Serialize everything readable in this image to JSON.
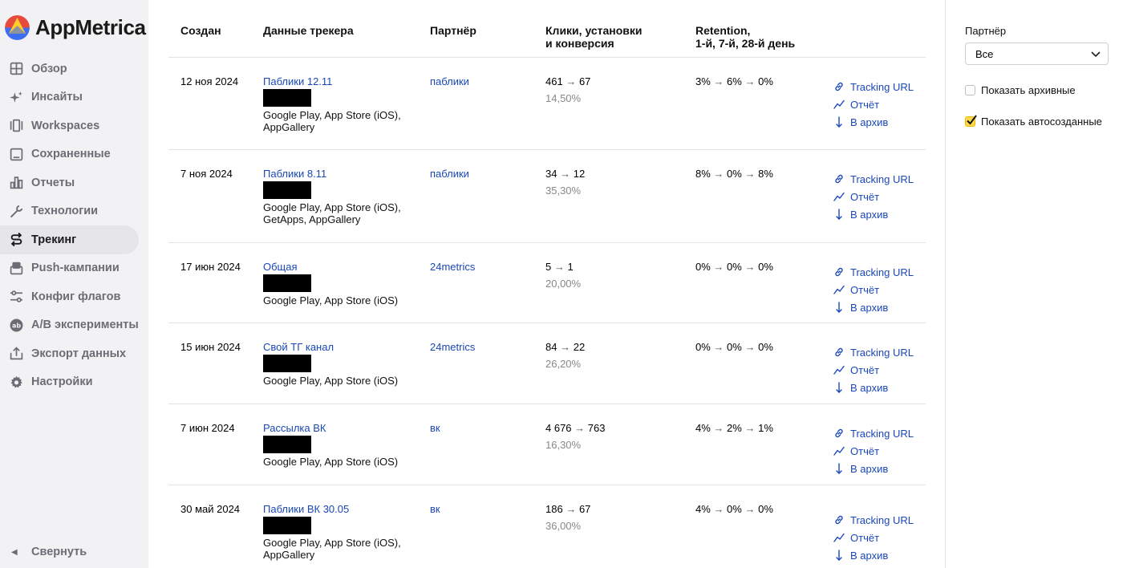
{
  "app": {
    "name": "AppMetrica"
  },
  "sidebar": {
    "items": [
      {
        "label": "Обзор",
        "icon": "overview-grid-icon",
        "active": false
      },
      {
        "label": "Инсайты",
        "icon": "sparkle-icon",
        "active": false
      },
      {
        "label": "Workspaces",
        "icon": "workspaces-icon",
        "active": false
      },
      {
        "label": "Сохраненные",
        "icon": "saved-icon",
        "active": false
      },
      {
        "label": "Отчеты",
        "icon": "reports-chart-icon",
        "active": false
      },
      {
        "label": "Технологии",
        "icon": "wrench-icon",
        "active": false
      },
      {
        "label": "Трекинг",
        "icon": "tracking-icon",
        "active": true
      },
      {
        "label": "Push-кампании",
        "icon": "push-icon",
        "active": false
      },
      {
        "label": "Конфиг флагов",
        "icon": "sliders-icon",
        "active": false
      },
      {
        "label": "A/B эксперименты",
        "icon": "ab-icon",
        "active": false
      },
      {
        "label": "Экспорт данных",
        "icon": "export-icon",
        "active": false
      },
      {
        "label": "Настройки",
        "icon": "gear-icon",
        "active": false
      }
    ],
    "collapse_label": "Свернуть"
  },
  "table": {
    "headers": {
      "created": "Создан",
      "tracker": "Данные трекера",
      "partner": "Партнёр",
      "clicks_line1": "Клики, установки",
      "clicks_line2": "и конверсия",
      "retention_line1": "Retention,",
      "retention_line2": "1-й, 7-й, 28-й день"
    },
    "rows": [
      {
        "date": "12 ноя 2024",
        "name": "Паблики 12.11",
        "stores": "Google Play, App Store (iOS), AppGallery",
        "partner": "паблики",
        "clicks": "461",
        "installs": "67",
        "conversion": "14,50%",
        "r1": "3%",
        "r7": "6%",
        "r28": "0%"
      },
      {
        "date": "7 ноя 2024",
        "name": "Паблики 8.11",
        "stores": "Google Play, App Store (iOS), GetApps, AppGallery",
        "partner": "паблики",
        "clicks": "34",
        "installs": "12",
        "conversion": "35,30%",
        "r1": "8%",
        "r7": "0%",
        "r28": "8%"
      },
      {
        "date": "17 июн 2024",
        "name": "Общая",
        "stores": "Google Play, App Store (iOS)",
        "partner": "24metrics",
        "clicks": "5",
        "installs": "1",
        "conversion": "20,00%",
        "r1": "0%",
        "r7": "0%",
        "r28": "0%"
      },
      {
        "date": "15 июн 2024",
        "name": "Свой ТГ канал",
        "stores": "Google Play, App Store (iOS)",
        "partner": "24metrics",
        "clicks": "84",
        "installs": "22",
        "conversion": "26,20%",
        "r1": "0%",
        "r7": "0%",
        "r28": "0%"
      },
      {
        "date": "7 июн 2024",
        "name": "Рассылка ВК",
        "stores": "Google Play, App Store (iOS)",
        "partner": "вк",
        "clicks": "4 676",
        "installs": "763",
        "conversion": "16,30%",
        "r1": "4%",
        "r7": "2%",
        "r28": "1%"
      },
      {
        "date": "30 май 2024",
        "name": "Паблики ВК 30.05",
        "stores": "Google Play, App Store (iOS), AppGallery",
        "partner": "вк",
        "clicks": "186",
        "installs": "67",
        "conversion": "36,00%",
        "r1": "4%",
        "r7": "0%",
        "r28": "0%"
      }
    ],
    "arrow": "→",
    "actions": {
      "tracking_url": "Tracking URL",
      "report": "Отчёт",
      "archive": "В архив"
    }
  },
  "filter": {
    "partner_label": "Партнёр",
    "partner_value": "Все",
    "show_archived_label": "Показать архивные",
    "show_archived_checked": false,
    "show_auto_label": "Показать автосозданные",
    "show_auto_checked": true
  }
}
